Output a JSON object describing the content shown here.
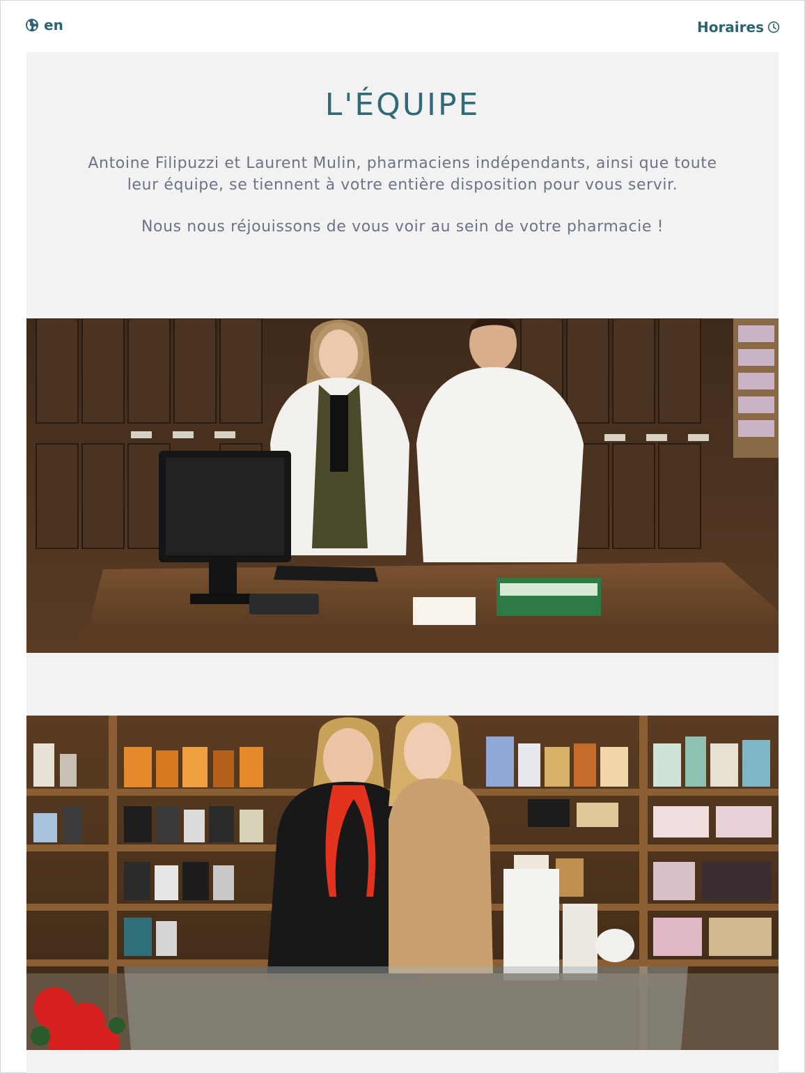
{
  "header": {
    "language": {
      "label": "en",
      "icon": "globe-icon"
    },
    "hours": {
      "label": "Horaires",
      "icon": "clock-icon"
    }
  },
  "team": {
    "title": "L'ÉQUIPE",
    "paragraph1": "Antoine Filipuzzi et Laurent Mulin, pharmaciens indépendants, ainsi que toute leur équipe, se tiennent à votre entière disposition pour vous servir.",
    "paragraph2": "Nous nous réjouissons de vous voir au sein de votre pharmacie !"
  },
  "photos": [
    {
      "subject": "pharmacists at counter"
    },
    {
      "subject": "team in perfume section"
    }
  ],
  "colors": {
    "accent": "#2b6470",
    "title": "#2f6b76",
    "body_text": "#6b7384",
    "section_background": "#f2f2f2"
  }
}
